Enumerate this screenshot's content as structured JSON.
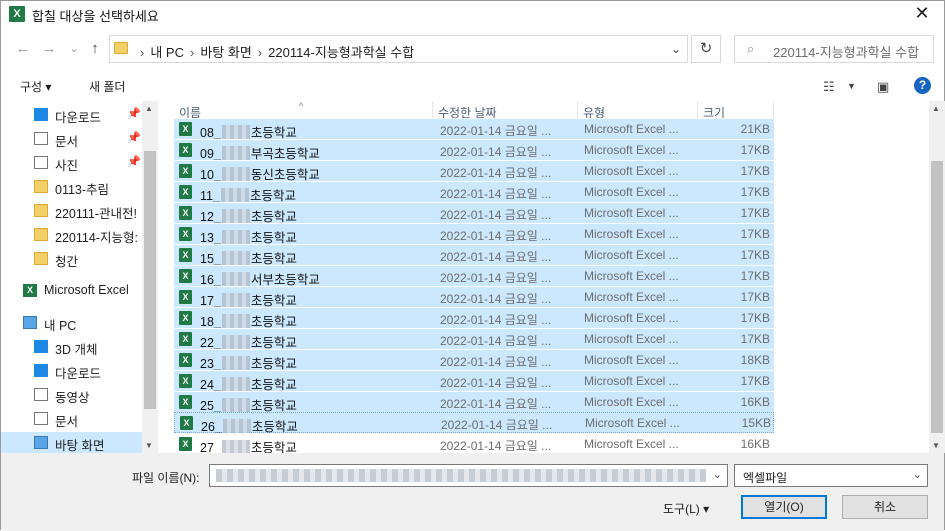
{
  "window": {
    "title": "합칠 대상을 선택하세요",
    "app_icon": "X",
    "close": "✕"
  },
  "nav": {
    "back": "←",
    "forward": "→",
    "recent": "⌄",
    "up": "↑",
    "crumbs": [
      "내 PC",
      "바탕 화면",
      "220114-지능형과학실 수합"
    ],
    "crumb_sep": "›",
    "refresh": "↻",
    "search_placeholder": "220114-지능형과학실 수합",
    "search_icon": "⌕"
  },
  "toolbar": {
    "organize": "구성 ▾",
    "new_folder": "새 폴더",
    "help": "?"
  },
  "sidebar": {
    "items": [
      {
        "label": "다운로드",
        "icon": "download-icon",
        "pinned": true
      },
      {
        "label": "문서",
        "icon": "document-icon",
        "pinned": true
      },
      {
        "label": "사진",
        "icon": "picture-icon",
        "pinned": true
      },
      {
        "label": "0113-추림",
        "icon": "folder-icon",
        "pinned": false
      },
      {
        "label": "220111-관내전!",
        "icon": "folder-icon",
        "pinned": false
      },
      {
        "label": "220114-지능형:",
        "icon": "folder-icon",
        "pinned": false
      },
      {
        "label": "청간",
        "icon": "folder-icon",
        "pinned": false
      },
      {
        "label": "Microsoft Excel",
        "icon": "excel-icon",
        "pinned": false
      },
      {
        "label": "내 PC",
        "icon": "pc-icon",
        "pinned": false
      },
      {
        "label": "3D 개체",
        "icon": "3d-icon",
        "pinned": false
      },
      {
        "label": "다운로드",
        "icon": "download-icon",
        "pinned": false
      },
      {
        "label": "동영상",
        "icon": "video-icon",
        "pinned": false
      },
      {
        "label": "문서",
        "icon": "document-icon",
        "pinned": false
      },
      {
        "label": "바탕 화면",
        "icon": "desktop-icon",
        "pinned": false
      }
    ],
    "pin_glyph": "📌"
  },
  "columns": {
    "name": "이름",
    "modified": "수정한 날짜",
    "type": "유형",
    "size": "크기",
    "sort_glyph": "^"
  },
  "files": [
    {
      "prefix": "08_",
      "suffix": "초등학교",
      "date": "2022-01-14 금요일 ...",
      "type": "Microsoft Excel ...",
      "size": "21KB"
    },
    {
      "prefix": "09_",
      "suffix": "부곡초등학교",
      "date": "2022-01-14 금요일 ...",
      "type": "Microsoft Excel ...",
      "size": "17KB"
    },
    {
      "prefix": "10_",
      "suffix": "동신초등학교",
      "date": "2022-01-14 금요일 ...",
      "type": "Microsoft Excel ...",
      "size": "17KB"
    },
    {
      "prefix": "11_",
      "suffix": "초등학교",
      "date": "2022-01-14 금요일 ...",
      "type": "Microsoft Excel ...",
      "size": "17KB"
    },
    {
      "prefix": "12_",
      "suffix": "초등학교",
      "date": "2022-01-14 금요일 ...",
      "type": "Microsoft Excel ...",
      "size": "17KB"
    },
    {
      "prefix": "13_",
      "suffix": "초등학교",
      "date": "2022-01-14 금요일 ...",
      "type": "Microsoft Excel ...",
      "size": "17KB"
    },
    {
      "prefix": "15_",
      "suffix": "초등학교",
      "date": "2022-01-14 금요일 ...",
      "type": "Microsoft Excel ...",
      "size": "17KB"
    },
    {
      "prefix": "16_",
      "suffix": "서부초등학교",
      "date": "2022-01-14 금요일 ...",
      "type": "Microsoft Excel ...",
      "size": "17KB"
    },
    {
      "prefix": "17_",
      "suffix": "초등학교",
      "date": "2022-01-14 금요일 ...",
      "type": "Microsoft Excel ...",
      "size": "17KB"
    },
    {
      "prefix": "18_",
      "suffix": "초등학교",
      "date": "2022-01-14 금요일 ...",
      "type": "Microsoft Excel ...",
      "size": "17KB"
    },
    {
      "prefix": "22_",
      "suffix": "초등학교",
      "date": "2022-01-14 금요일 ...",
      "type": "Microsoft Excel ...",
      "size": "17KB"
    },
    {
      "prefix": "23_",
      "suffix": "초등학교",
      "date": "2022-01-14 금요일 ...",
      "type": "Microsoft Excel ...",
      "size": "18KB"
    },
    {
      "prefix": "24_",
      "suffix": "초등학교",
      "date": "2022-01-14 금요일 ...",
      "type": "Microsoft Excel ...",
      "size": "17KB"
    },
    {
      "prefix": "25_",
      "suffix": "초등학교",
      "date": "2022-01-14 금요일 ...",
      "type": "Microsoft Excel ...",
      "size": "16KB"
    },
    {
      "prefix": "26_",
      "suffix": "초등학교",
      "date": "2022-01-14 금요일 ...",
      "type": "Microsoft Excel ...",
      "size": "15KB"
    },
    {
      "prefix": "27_",
      "suffix": "초등학교",
      "date": "2022-01-14 금요일 ...",
      "type": "Microsoft Excel ...",
      "size": "16KB"
    }
  ],
  "footer": {
    "filename_label": "파일 이름(N):",
    "file_type": "엑셀파일",
    "tools": "도구(L) ▾",
    "open": "열기(O)",
    "cancel": "취소",
    "dropdown_glyph": "⌄"
  },
  "colors": {
    "selection": "#cce8ff",
    "excel": "#1f7a45",
    "accent": "#0078d7"
  }
}
